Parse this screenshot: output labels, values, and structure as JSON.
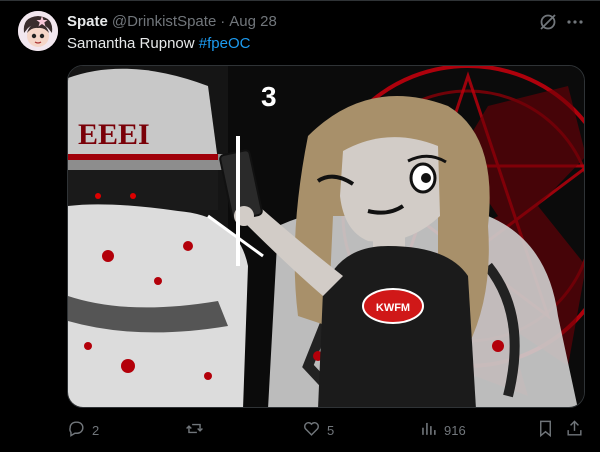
{
  "tweet": {
    "author_name": "Spate",
    "author_handle": "@DrinkistSpate",
    "separator": "·",
    "date": "Aug 28",
    "text_prefix": "Samantha Rupnow ",
    "hashtag": "#fpeOC",
    "media": {
      "hat_text": "EEEI",
      "number_3": "3",
      "shirt_logo": "KWFM"
    }
  },
  "actions": {
    "replies": "2",
    "retweets": "",
    "likes": "5",
    "views": "916"
  },
  "icons": [
    "avatar",
    "grok-icon",
    "more-icon",
    "reply-icon",
    "retweet-icon",
    "like-icon",
    "views-icon",
    "bookmark-icon",
    "share-icon"
  ],
  "colors": {
    "background": "#000000",
    "text": "#e7e9ea",
    "muted": "#71767b",
    "link": "#1d9bf0",
    "blood": "#b3000a"
  }
}
